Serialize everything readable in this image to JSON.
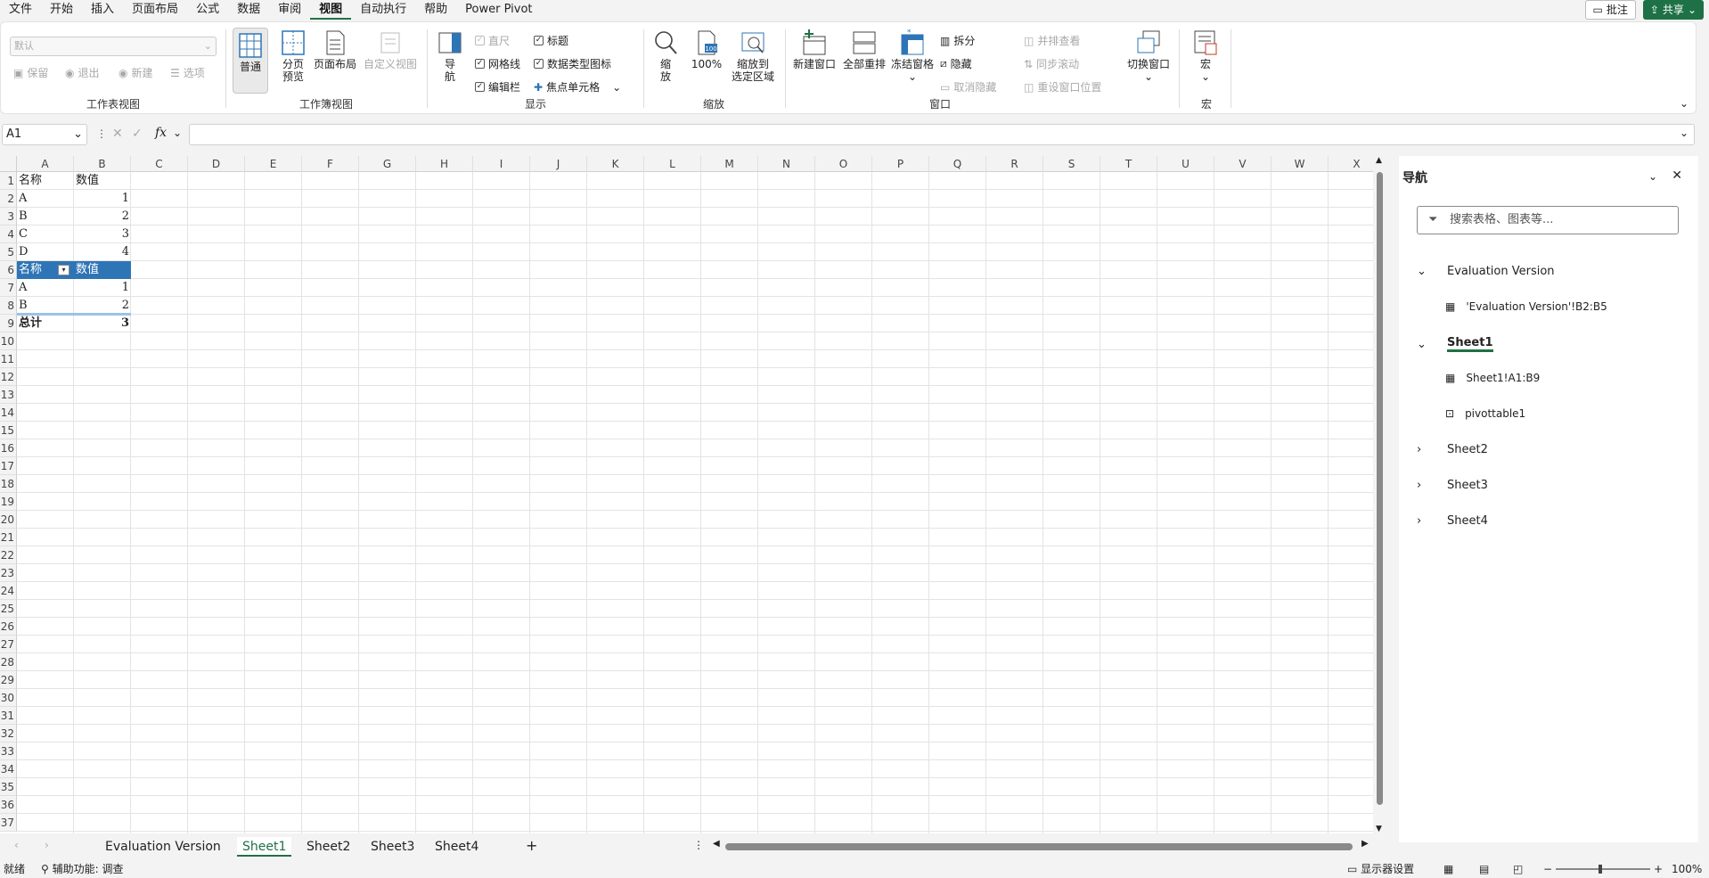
{
  "menu": {
    "tabs": [
      "文件",
      "开始",
      "插入",
      "页面布局",
      "公式",
      "数据",
      "审阅",
      "视图",
      "自动执行",
      "帮助",
      "Power Pivot"
    ],
    "active_tab": "视图",
    "comment_label": "批注",
    "share_label": "共享"
  },
  "ribbon": {
    "sheet_view": {
      "dropdown_value": "默认",
      "keep_label": "保留",
      "exit_label": "退出",
      "new_label": "新建",
      "options_label": "选项",
      "group_label": "工作表视图"
    },
    "workbook_views": {
      "normal_label": "普通",
      "page_break_label": "分页\n预览",
      "page_layout_label": "页面布局",
      "custom_label": "自定义视图",
      "group_label": "工作簿视图"
    },
    "show": {
      "nav_label": "导\n航",
      "ruler_label": "直尺",
      "gridlines_label": "网格线",
      "formula_bar_label": "编辑栏",
      "headings_label": "标题",
      "data_type_icons_label": "数据类型图标",
      "focus_cell_label": "焦点单元格",
      "group_label": "显示"
    },
    "zoom": {
      "zoom_label": "缩\n放",
      "hundred_label": "100%",
      "zoom_selection_label": "缩放到\n选定区域",
      "group_label": "缩放"
    },
    "window": {
      "new_window_label": "新建窗口",
      "arrange_all_label": "全部重排",
      "freeze_label": "冻结窗格",
      "split_label": "拆分",
      "hide_label": "隐藏",
      "unhide_label": "取消隐藏",
      "side_by_side_label": "并排查看",
      "sync_scroll_label": "同步滚动",
      "reset_position_label": "重设窗口位置",
      "switch_label": "切换窗口",
      "group_label": "窗口"
    },
    "macros": {
      "macro_label": "宏",
      "group_label": "宏"
    }
  },
  "formula_bar": {
    "name_box": "A1",
    "fx_label": "fx",
    "formula": ""
  },
  "grid": {
    "columns": [
      "A",
      "B",
      "C",
      "D",
      "E",
      "F",
      "G",
      "H",
      "I",
      "J",
      "K",
      "L",
      "M",
      "N",
      "O",
      "P",
      "Q",
      "R",
      "S",
      "T",
      "U",
      "V",
      "W",
      "X"
    ],
    "rows": [
      "1",
      "2",
      "3",
      "4",
      "5",
      "6",
      "7",
      "8",
      "9",
      "10",
      "11",
      "12",
      "13",
      "14",
      "15",
      "16",
      "17",
      "18",
      "19",
      "20",
      "21",
      "22",
      "23",
      "24",
      "25",
      "26",
      "27",
      "28",
      "29",
      "30",
      "31",
      "32",
      "33",
      "34",
      "35",
      "36",
      "37"
    ],
    "cells": {
      "A1": "名称",
      "B1": "数值",
      "A2": "A",
      "B2": "1",
      "A3": "B",
      "B3": "2",
      "A4": "C",
      "B4": "3",
      "A5": "D",
      "B5": "4",
      "A6": "名称",
      "B6": "数值",
      "A7": "A",
      "B7": "1",
      "A8": "B",
      "B8": "2",
      "A9": "总计",
      "B9": "3"
    }
  },
  "sheets": {
    "tabs": [
      "Evaluation Version",
      "Sheet1",
      "Sheet2",
      "Sheet3",
      "Sheet4"
    ],
    "active": "Sheet1"
  },
  "nav_pane": {
    "title": "导航",
    "search_placeholder": "搜索表格、图表等...",
    "items": [
      {
        "label": "Evaluation Version",
        "type": "sheet",
        "expanded": true
      },
      {
        "label": "'Evaluation Version'!B2:B5",
        "type": "range"
      },
      {
        "label": "Sheet1",
        "type": "sheet",
        "expanded": true,
        "active": true
      },
      {
        "label": "Sheet1!A1:B9",
        "type": "range"
      },
      {
        "label": "pivottable1",
        "type": "pivot"
      },
      {
        "label": "Sheet2",
        "type": "sheet",
        "expanded": false
      },
      {
        "label": "Sheet3",
        "type": "sheet",
        "expanded": false
      },
      {
        "label": "Sheet4",
        "type": "sheet",
        "expanded": false
      }
    ]
  },
  "status": {
    "ready": "就绪",
    "accessibility": "辅助功能: 调查",
    "display_settings": "显示器设置",
    "zoom": "100%"
  }
}
